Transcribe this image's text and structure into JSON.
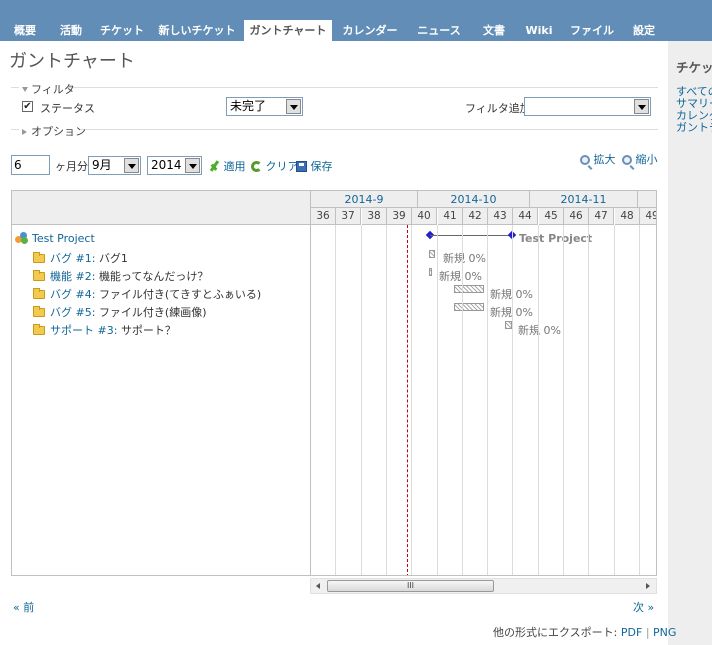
{
  "menu": {
    "tabs": [
      {
        "label": "概要"
      },
      {
        "label": "活動"
      },
      {
        "label": "チケット"
      },
      {
        "label": "新しいチケット"
      },
      {
        "label": "ガントチャート"
      },
      {
        "label": "カレンダー"
      },
      {
        "label": "ニュース"
      },
      {
        "label": "文書"
      },
      {
        "label": "Wiki"
      },
      {
        "label": "ファイル"
      },
      {
        "label": "設定"
      }
    ],
    "selected": "ガントチャート"
  },
  "sidebar": {
    "title": "チケッ",
    "links": [
      "すべての",
      "サマリー",
      "カレンダ",
      "ガントチ"
    ]
  },
  "page": {
    "title": "ガントチャート"
  },
  "filters": {
    "legend": "フィルタ",
    "status_label": "ステータス",
    "status_checked": "✔",
    "status_value": "未完了",
    "add_filter_label": "フィルタ追加",
    "add_filter_value": ""
  },
  "options": {
    "legend": "オプション"
  },
  "period": {
    "months": "6",
    "months_suffix": "ヶ月分",
    "month_value": "9月",
    "year_value": "2014",
    "apply": "適用",
    "clear": "クリア",
    "save": "保存",
    "zoom_in": "拡大",
    "zoom_out": "縮小"
  },
  "gantt": {
    "months": [
      "2014-9",
      "2014-10",
      "2014-11"
    ],
    "weeks": [
      "36",
      "37",
      "38",
      "39",
      "40",
      "41",
      "42",
      "43",
      "44",
      "45",
      "46",
      "47",
      "48",
      "49"
    ],
    "project": {
      "name": "Test Project",
      "bar_label": "Test Project"
    },
    "issues": [
      {
        "tracker": "バグ",
        "number": "#1",
        "subject": "バグ1",
        "status": "新規",
        "progress": "0%"
      },
      {
        "tracker": "機能",
        "number": "#2",
        "subject": "機能ってなんだっけ？",
        "status": "新規",
        "progress": "0%"
      },
      {
        "tracker": "バグ",
        "number": "#4",
        "subject": "ファイル付き(てきすとふぁいる)",
        "status": "新規",
        "progress": "0%"
      },
      {
        "tracker": "バグ",
        "number": "#5",
        "subject": "ファイル付き(練画像)",
        "status": "新規",
        "progress": "0%"
      },
      {
        "tracker": "サポート",
        "number": "#3",
        "subject": "サポート？",
        "status": "新規",
        "progress": "0%"
      }
    ],
    "scroll_thumb": "III"
  },
  "pagination": {
    "prev": "« 前",
    "next": "次 »"
  },
  "export": {
    "label": "他の形式にエクスポート:",
    "pdf": "PDF",
    "separator": "|",
    "png": "PNG"
  },
  "colors": {
    "menu_bg": "#628DB6",
    "link": "#169",
    "today_line": "#cc0000",
    "diamond": "#2222cc"
  }
}
